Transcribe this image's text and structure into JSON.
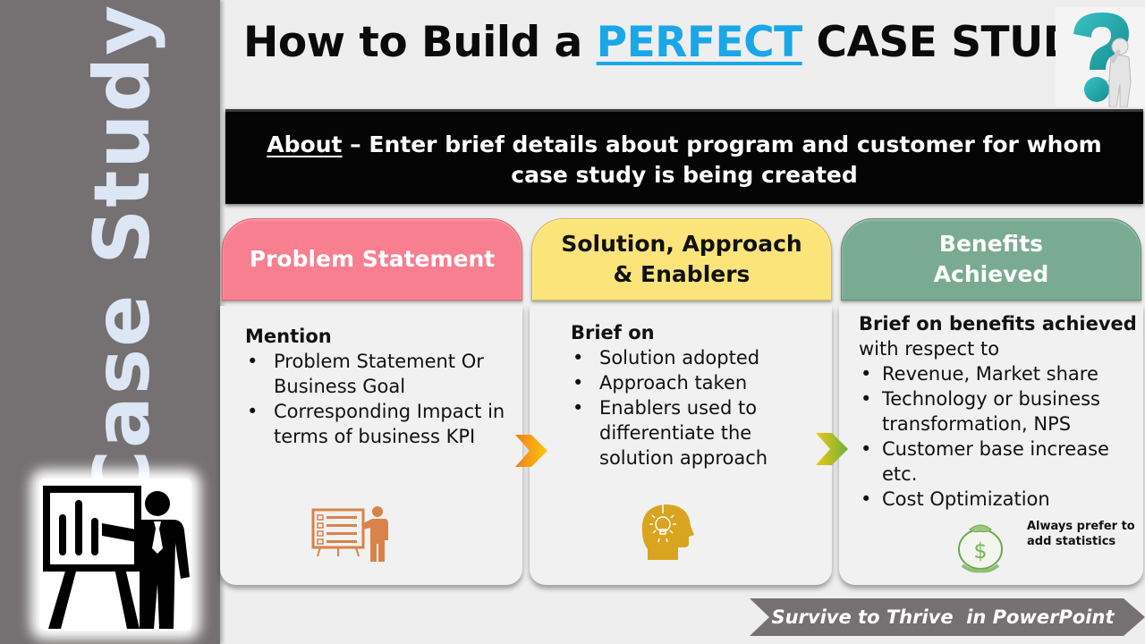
{
  "sidebar": {
    "title": "Case Study",
    "icon": "presenter-chart-icon",
    "background_color": "#757071",
    "title_color": "#dce6f4"
  },
  "header": {
    "title_prefix": "How to Build a ",
    "title_accent": "PERFECT",
    "title_suffix": " CASE STUDY",
    "accent_color": "#1aa7e8",
    "icon": "question-mark-thinker-icon"
  },
  "about": {
    "label": "About",
    "text_line1": " – Enter brief details about program and customer for whom",
    "text_line2": "case study is being created"
  },
  "columns": [
    {
      "header": "Problem Statement",
      "header_color": "#f77f8f",
      "heading": "Mention",
      "items": [
        "Problem Statement Or Business Goal",
        "Corresponding Impact in terms of business KPI"
      ],
      "icon": "presentation-board-icon"
    },
    {
      "header_line1": "Solution, Approach",
      "header_line2": "& Enablers",
      "header_color": "#fbe47a",
      "heading": "Brief on",
      "items": [
        "Solution adopted",
        "Approach taken",
        "Enablers used to differentiate the solution approach"
      ],
      "icon": "lightbulb-head-icon"
    },
    {
      "header_line1": "Benefits",
      "header_line2": "Achieved",
      "header_color": "#7aab92",
      "heading": "Brief on benefits achieved",
      "subheading": "with respect to",
      "items": [
        "Revenue, Market share",
        "Technology or business transformation, NPS",
        "Customer base increase etc.",
        "Cost Optimization"
      ],
      "note_line1": "Always prefer to",
      "note_line2": "add statistics",
      "icon": "money-bag-icon"
    }
  ],
  "footer": {
    "text": "Survive to Thrive  in PowerPoint",
    "background_color": "#757071"
  }
}
